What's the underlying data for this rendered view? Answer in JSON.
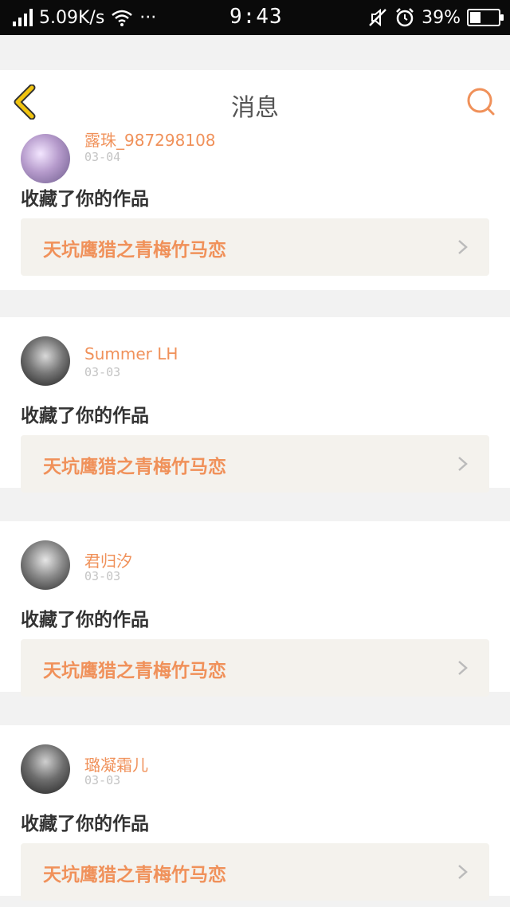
{
  "status_bar": {
    "speed": "5.09K/s",
    "more": "···",
    "time": "9:43",
    "battery": "39%",
    "battery_level": 0.39
  },
  "header": {
    "title": "消息",
    "back_icon": "back-chevron-icon",
    "search_icon": "search-icon"
  },
  "messages": [
    {
      "username": "露珠_987298108",
      "date": "03-04",
      "action": "收藏了你的作品",
      "work_title": "天坑鹰猎之青梅竹马恋"
    },
    {
      "username": "Summer  LH",
      "date": "03-03",
      "action": "收藏了你的作品",
      "work_title": "天坑鹰猎之青梅竹马恋"
    },
    {
      "username": "君归汐",
      "date": "03-03",
      "action": "收藏了你的作品",
      "work_title": "天坑鹰猎之青梅竹马恋"
    },
    {
      "username": "璐凝霜儿",
      "date": "03-03",
      "action": "收藏了你的作品",
      "work_title": "天坑鹰猎之青梅竹马恋"
    }
  ],
  "colors": {
    "accent": "#f0915a",
    "back_icon": "#f1c40f",
    "search_icon": "#f0915a"
  }
}
